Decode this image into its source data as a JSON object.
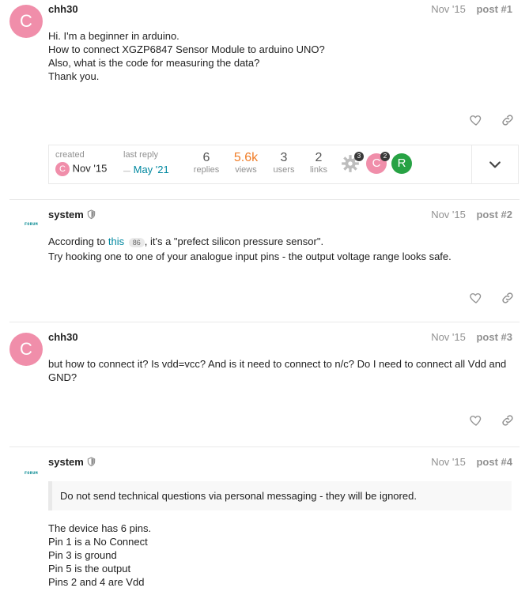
{
  "posts": [
    {
      "username": "chh30",
      "avatar_letter": "C",
      "date": "Nov '15",
      "post_number": "post #1",
      "lines": [
        "Hi. I'm a beginner in arduino.",
        "How to connect XGZP6847 Sensor Module to arduino UNO?",
        "Also, what is the code for measuring the data?",
        "Thank you."
      ]
    },
    {
      "username": "system",
      "avatar_logo": "FORUM",
      "date": "Nov '15",
      "post_number": "post #2",
      "line1_before": "According to ",
      "line1_link": "this",
      "line1_clicks": "86",
      "line1_after": ", it's a \"prefect silicon pressure sensor\".",
      "line2": "Try hooking one to one of your analogue input pins - the output voltage range looks safe."
    },
    {
      "username": "chh30",
      "avatar_letter": "C",
      "date": "Nov '15",
      "post_number": "post #3",
      "text": "but how to connect it? Is vdd=vcc? And is it need to connect to n/c? Do I need to connect all Vdd and GND?"
    },
    {
      "username": "system",
      "avatar_logo": "FORUM",
      "date": "Nov '15",
      "post_number": "post #4",
      "quote": "Do not send technical questions via personal messaging - they will be ignored.",
      "lines": [
        "The device has 6 pins.",
        "Pin 1 is a No Connect",
        "Pin 3 is ground",
        "Pin 5 is the output",
        "Pins 2 and 4 are Vdd"
      ]
    }
  ],
  "summary": {
    "created_label": "created",
    "created_avatar": "C",
    "created_date": "Nov '15",
    "last_reply_label": "last reply",
    "last_reply_date": "May '21",
    "replies_num": "6",
    "replies_label": "replies",
    "views_num": "5.6k",
    "views_label": "views",
    "users_num": "3",
    "users_label": "users",
    "links_num": "2",
    "links_label": "links",
    "participants": [
      {
        "letter": "",
        "count": "3",
        "color": "#bdbdbd"
      },
      {
        "letter": "C",
        "count": "2",
        "color": "#f08eaa"
      },
      {
        "letter": "R",
        "count": "",
        "color": "#27a244"
      }
    ]
  },
  "colors": {
    "accent": "#0088a0",
    "avatar_pink": "#f08eaa",
    "views_orange": "#f07d28",
    "avatar_green": "#27a244"
  },
  "icons": [
    "heart-icon",
    "link-icon",
    "shield-icon",
    "chevron-down-icon",
    "gear-icon"
  ]
}
